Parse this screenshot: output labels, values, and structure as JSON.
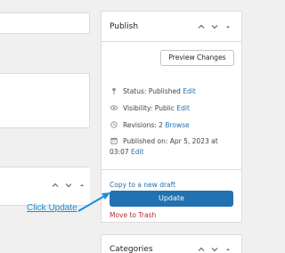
{
  "publish": {
    "title": "Publish",
    "preview_label": "Preview Changes",
    "status_label": "Status: Published ",
    "status_link": "Edit",
    "visibility_label": "Visibility: Public ",
    "visibility_link": "Edit",
    "revisions_label": "Revisions: 2 ",
    "revisions_link": "Browse",
    "published_label": "Published on: Apr 5, 2023 at",
    "published_time": "03:07 ",
    "published_link": "Edit",
    "copy_link": "Copy to a new draft",
    "update_label": "Update",
    "trash_link": "Move to Trash"
  },
  "categories": {
    "title": "Categories"
  },
  "annotation": {
    "text": "Click Update"
  },
  "icons": {
    "panel_controls": [
      "chevron-up-icon",
      "chevron-down-icon",
      "caret-up-icon"
    ],
    "status": "pin-icon",
    "visibility": "eye-icon",
    "revisions": "history-icon",
    "published": "calendar-icon"
  },
  "colors": {
    "accent": "#2271b1",
    "trash": "#b32d2e",
    "annotation": "#1e8fd6"
  }
}
